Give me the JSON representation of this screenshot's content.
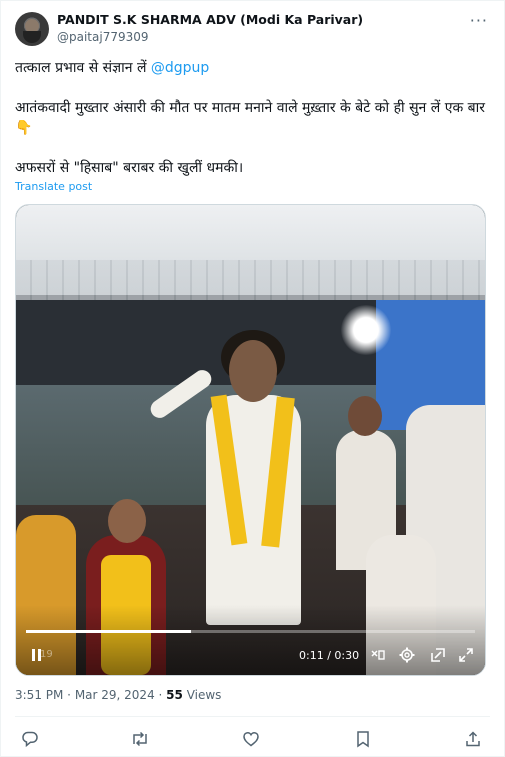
{
  "author": {
    "name": "PANDIT S.K SHARMA ADV (Modi Ka Parivar)",
    "handle": "@paitaj779309"
  },
  "post": {
    "line1_prefix": "तत्काल प्रभाव से संज्ञान लें ",
    "line1_mention": "@dgpup",
    "line2": "आतंकवादी मुख्तार अंसारी की मौत पर मातम मनाने वाले मुख़्तार के बेटे को ही सुन लें एक बार 👇",
    "line3": "अफसरों से \"हिसाब\" बराबर की खुलीं धमकी।",
    "translate_label": "Translate post"
  },
  "video": {
    "time_display": "0:11 / 0:30",
    "progress_fraction": 0.367,
    "ghost_time": "19"
  },
  "meta": {
    "time": "3:51 PM",
    "separator": " · ",
    "date": "Mar 29, 2024",
    "views_count": "55",
    "views_label": " Views"
  },
  "icons": {
    "more": "more-icon",
    "play_pause": "pause-icon",
    "captions": "captions-icon",
    "settings": "gear-icon",
    "pip": "picture-in-picture-icon",
    "fullscreen": "fullscreen-icon",
    "reply": "reply-icon",
    "repost": "repost-icon",
    "like": "like-icon",
    "bookmark": "bookmark-icon",
    "share": "share-icon"
  },
  "colors": {
    "accent": "#1d9bf0",
    "secondary_text": "#536471",
    "primary_text": "#0f1419"
  }
}
